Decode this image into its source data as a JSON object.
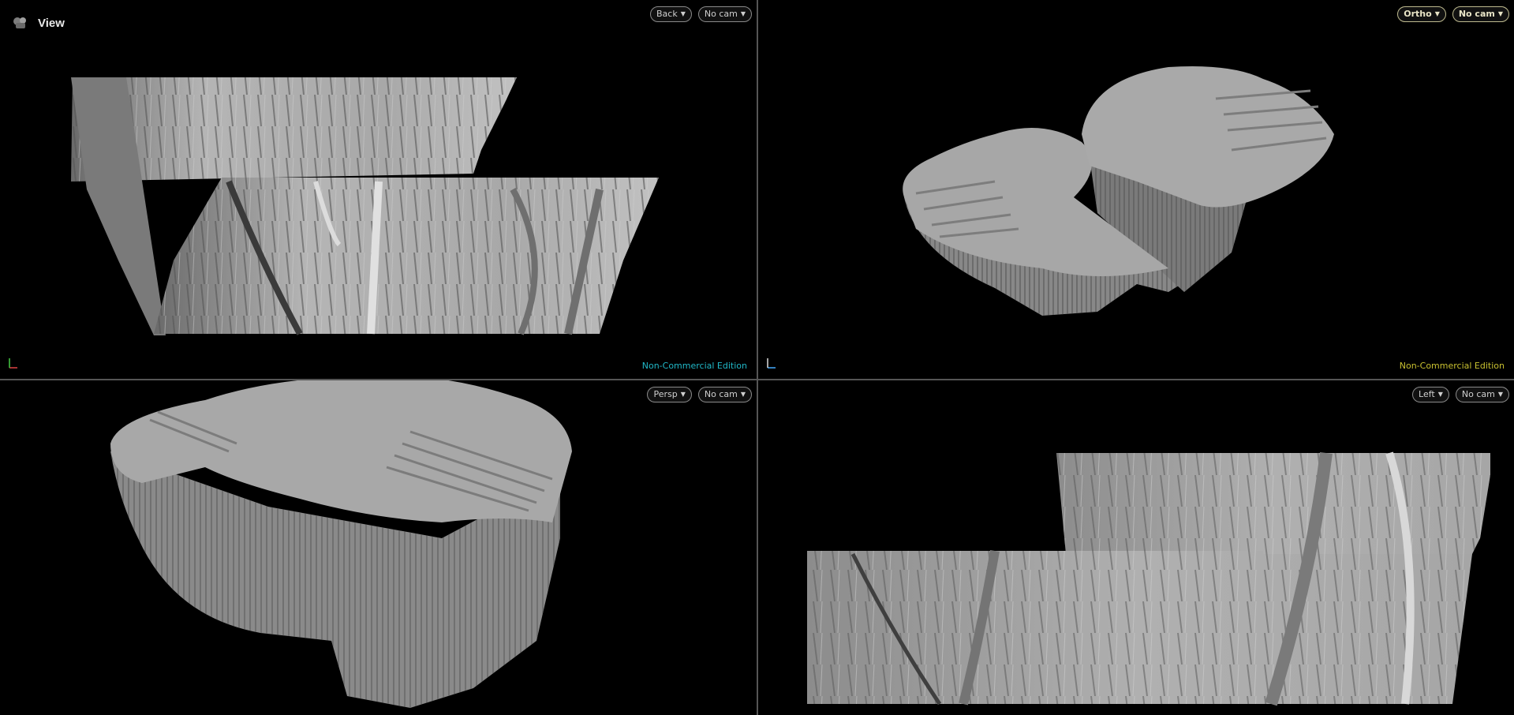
{
  "app": {
    "title": "View"
  },
  "viewports": {
    "top_left": {
      "view": "Back",
      "camera": "No cam",
      "watermark": "Non-Commercial Edition"
    },
    "top_right": {
      "view": "Ortho",
      "camera": "No cam",
      "watermark": "Non-Commercial Edition"
    },
    "bottom_left": {
      "view": "Persp",
      "camera": "No cam"
    },
    "bottom_right": {
      "view": "Left",
      "camera": "No cam"
    }
  },
  "colors": {
    "background": "#000000",
    "divider": "#555555",
    "mesh": "#9a9a9a",
    "watermark_cyan": "#20b8c8",
    "watermark_yellow": "#c8c030"
  }
}
